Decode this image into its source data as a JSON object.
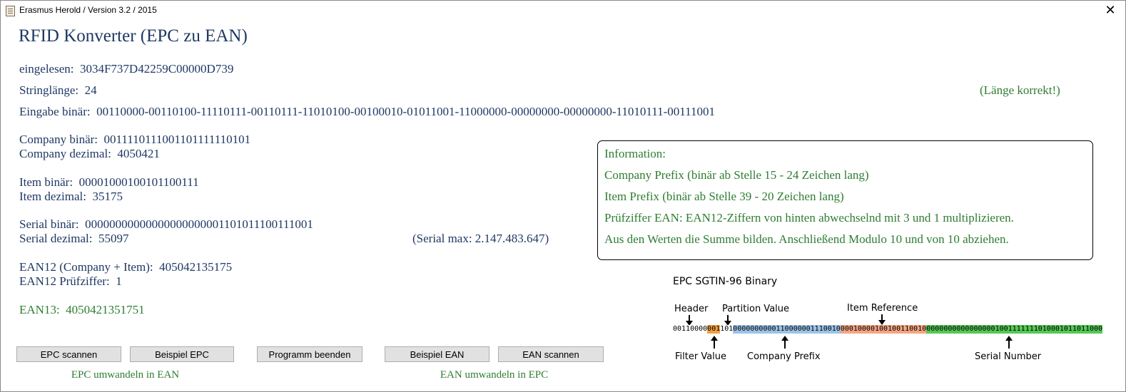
{
  "window": {
    "title": "Erasmus Herold / Version 3.2 / 2015",
    "close_label": "✕"
  },
  "heading": "RFID Konverter (EPC zu EAN)",
  "fields": {
    "eingelesen_label": "eingelesen:",
    "eingelesen_value": "3034F737D42259C00000D739",
    "stringlaenge_label": "Stringlänge:",
    "stringlaenge_value": "24",
    "laenge_status": "(Länge korrekt!)",
    "eingabe_label": "Eingabe binär:",
    "eingabe_value": "00110000-00110100-11110111-00110111-11010100-00100010-01011001-11000000-00000000-00000000-11010111-00111001",
    "company_bin_label": "Company binär:",
    "company_bin_value": "0011110111001101111110101",
    "company_dez_label": "Company dezimal:",
    "company_dez_value": "4050421",
    "item_bin_label": "Item binär:",
    "item_bin_value": "00001000100101100111",
    "item_dez_label": "Item dezimal:",
    "item_dez_value": "35175",
    "serial_bin_label": "Serial binär:",
    "serial_bin_value": "00000000000000000000001101011100111001",
    "serial_dez_label": "Serial dezimal:",
    "serial_dez_value": "55097",
    "serial_max": "(Serial max: 2.147.483.647)",
    "ean12_label": "EAN12 (Company + Item):",
    "ean12_value": "405042135175",
    "pruef_label": "EAN12 Prüfziffer:",
    "pruef_value": "1",
    "ean13_label": "EAN13:",
    "ean13_value": "4050421351751"
  },
  "info": {
    "title": "Information:",
    "lines": [
      "Company Prefix (binär ab Stelle 15 - 24 Zeichen lang)",
      "Item Prefix (binär ab Stelle 39 - 20 Zeichen lang)",
      "Prüfziffer EAN: EAN12-Ziffern von hinten abwechselnd mit 3 und 1 multiplizieren.",
      "Aus den Werten die Summe bilden. Anschließend Modulo 10 und von 10 abziehen."
    ]
  },
  "buttons": {
    "epc_scannen": "EPC scannen",
    "beispiel_epc": "Beispiel EPC",
    "programm_beenden": "Programm beenden",
    "beispiel_ean": "Beispiel EAN",
    "ean_scannen": "EAN scannen"
  },
  "captions": {
    "epc_to_ean": "EPC umwandeln in EAN",
    "ean_to_epc": "EAN umwandeln in EPC"
  },
  "diagram": {
    "title": "EPC SGTIN-96 Binary",
    "labels": {
      "header": "Header",
      "partition": "Partition Value",
      "item_ref": "Item Reference",
      "filter": "Filter Value",
      "company": "Company Prefix",
      "serial": "Serial Number"
    },
    "segments": [
      {
        "bits": "00110000",
        "color": "#ffffff"
      },
      {
        "bits": "001",
        "color": "#f0a040"
      },
      {
        "bits": "101",
        "color": "#ffffff"
      },
      {
        "bits": "0000000000110000001110010",
        "color": "#9cc3e6"
      },
      {
        "bits": "00010000100100110010",
        "color": "#f4a582"
      },
      {
        "bits": "00000000000000001001111111010001011011000",
        "color": "#55c855"
      }
    ]
  }
}
